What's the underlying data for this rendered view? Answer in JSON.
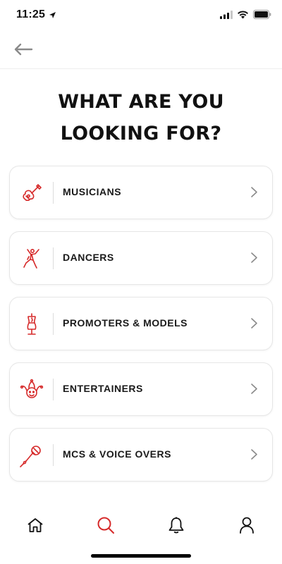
{
  "status_bar": {
    "time": "11:25",
    "icons": [
      "location-arrow-icon",
      "cellular-signal-icon",
      "wifi-icon",
      "battery-icon"
    ]
  },
  "header": {
    "back_icon": "arrow-left-icon"
  },
  "page": {
    "title": "WHAT ARE YOU\nLOOKING FOR?"
  },
  "categories": [
    {
      "label": "MUSICIANS",
      "icon": "guitar-icon"
    },
    {
      "label": "DANCERS",
      "icon": "dancer-icon"
    },
    {
      "label": "PROMOTERS & MODELS",
      "icon": "dress-form-icon"
    },
    {
      "label": "ENTERTAINERS",
      "icon": "jester-icon"
    },
    {
      "label": "MCS & VOICE OVERS",
      "icon": "microphone-icon"
    }
  ],
  "tab_bar": {
    "tabs": [
      {
        "name": "home",
        "icon": "home-icon",
        "active": false
      },
      {
        "name": "search",
        "icon": "search-icon",
        "active": true
      },
      {
        "name": "notifications",
        "icon": "bell-icon",
        "active": false
      },
      {
        "name": "profile",
        "icon": "user-icon",
        "active": false
      }
    ]
  },
  "colors": {
    "accent": "#d62a2a",
    "text": "#111111",
    "chevron": "#8a8a8a",
    "border": "#e6e6e6"
  }
}
